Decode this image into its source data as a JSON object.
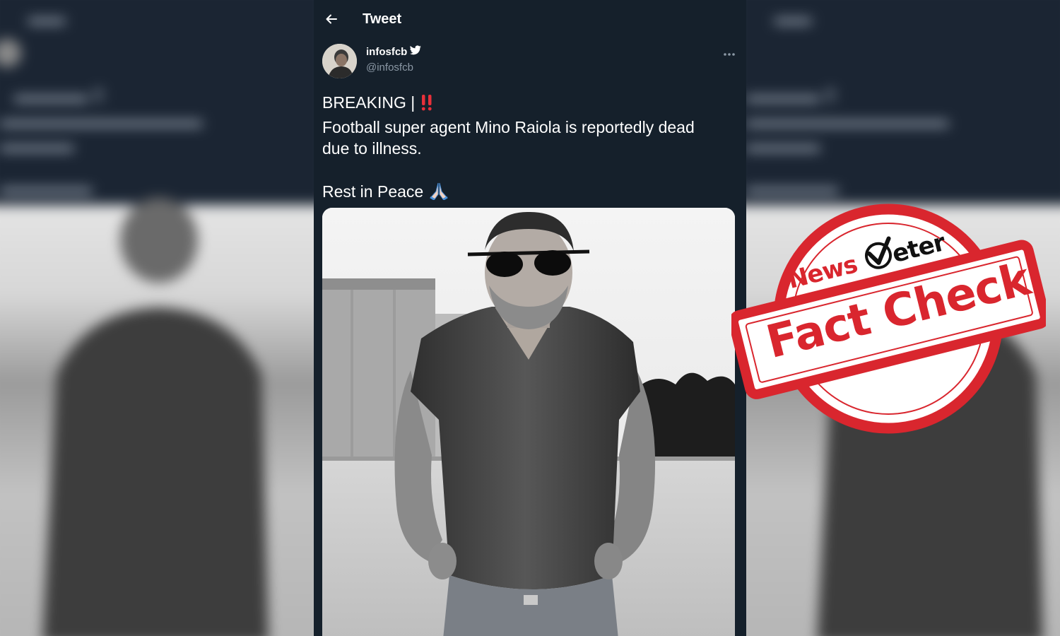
{
  "header": {
    "title": "Tweet"
  },
  "tweet": {
    "display_name": "infosfcb",
    "handle": "@infosfcb",
    "line1": "BREAKING |",
    "line2": "Football super agent Mino Raiola is reportedly dead",
    "line3": "due to illness.",
    "line4": "Rest in Peace"
  },
  "stamp": {
    "brand_part1": "News",
    "brand_part2": "eter",
    "label": "Fact Check",
    "color": "#d9262e"
  },
  "colors": {
    "tweet_background": "#15202b",
    "handle_text": "#8b98a5",
    "verified": "#ffffff"
  },
  "icons": [
    "back-arrow-icon",
    "verified-badge-icon",
    "more-options-icon",
    "double-exclamation-icon",
    "folded-hands-icon",
    "checkmark-icon"
  ]
}
